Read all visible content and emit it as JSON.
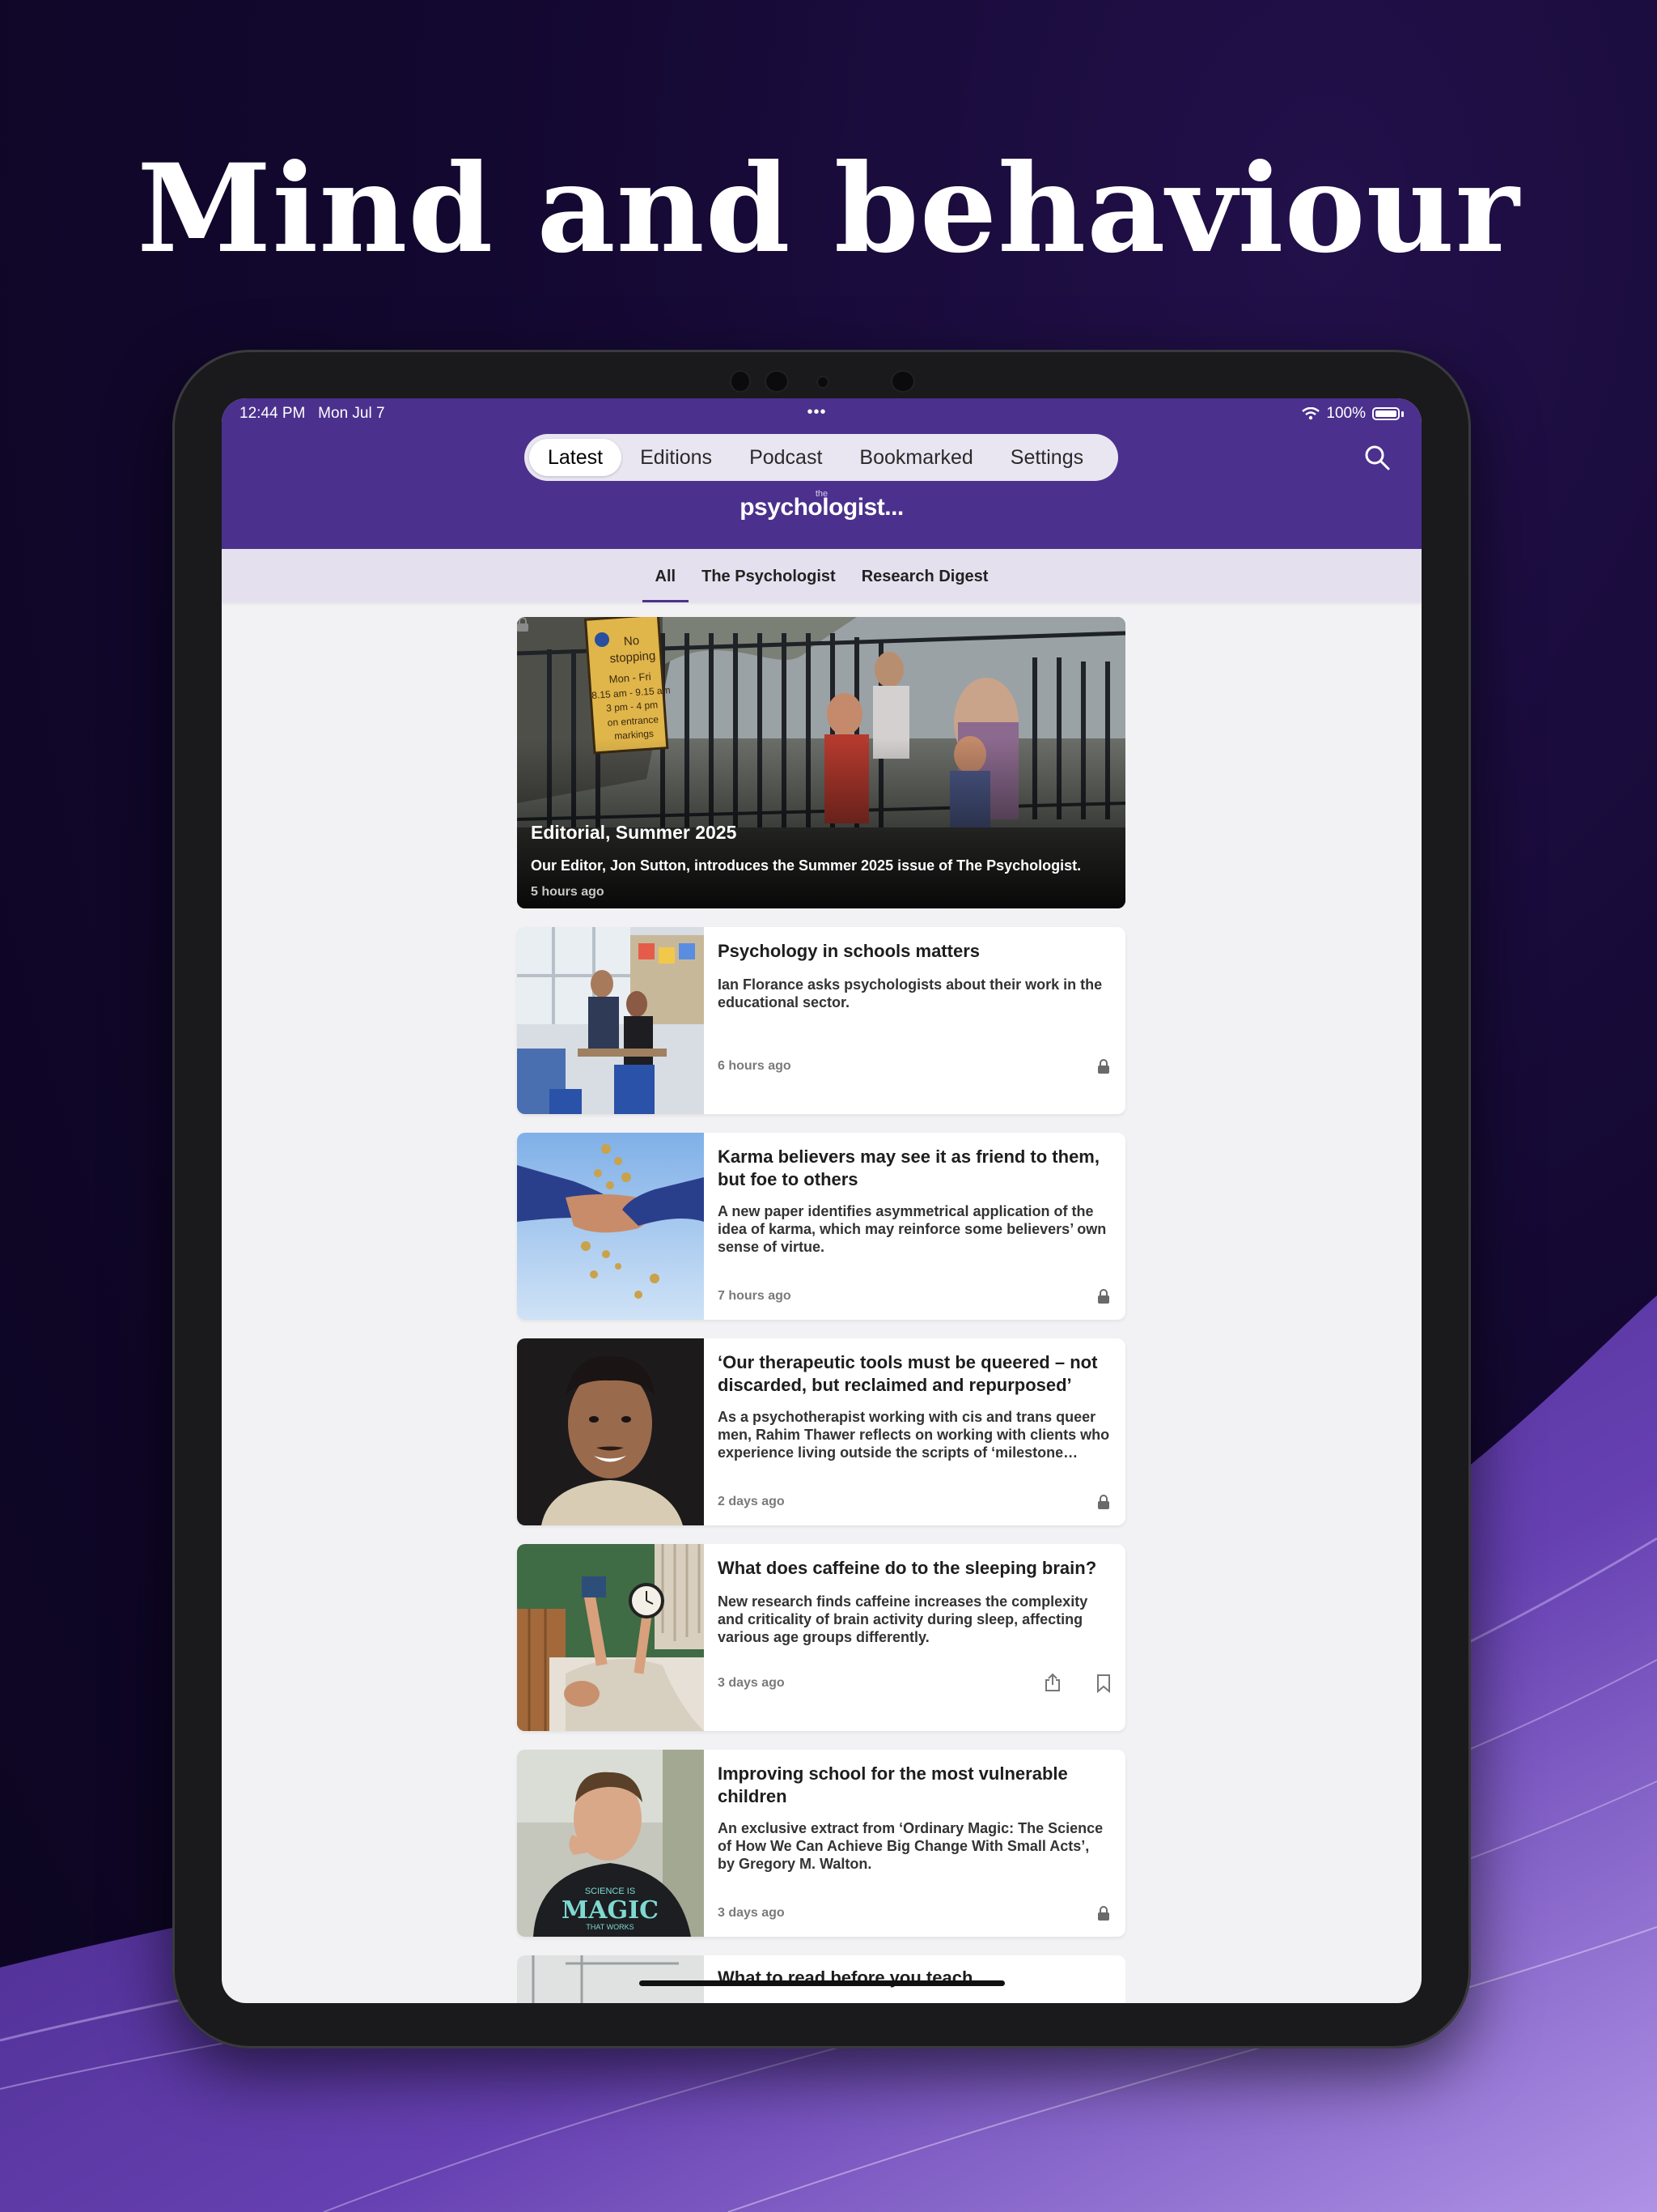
{
  "headline": "Mind and behaviour",
  "status": {
    "time": "12:44 PM",
    "date": "Mon Jul 7",
    "battery": "100%",
    "dots": "•••"
  },
  "nav": {
    "tabs": [
      "Latest",
      "Editions",
      "Podcast",
      "Bookmarked",
      "Settings"
    ],
    "active": "Latest"
  },
  "logo": {
    "small": "the",
    "word": "psychologist",
    "dots": "..."
  },
  "filters": {
    "items": [
      "All",
      "The Psychologist",
      "Research Digest"
    ],
    "active": "All"
  },
  "hero": {
    "title": "Editorial, Summer 2025",
    "summary": "Our Editor, Jon Sutton, introduces the Summer 2025 issue of The Psychologist.",
    "time": "5 hours ago",
    "sign_text": "No stopping Mon - Fri 8.15 am - 9.15 am 3 pm - 4 pm on entrance markings"
  },
  "articles": [
    {
      "title": "Psychology in schools matters",
      "summary": "Ian Florance asks psychologists about their work in the educational sector.",
      "time": "6 hours ago",
      "icon": "lock-icon"
    },
    {
      "title": "Karma believers may see it as friend to them, but foe to others",
      "summary": "A new paper identifies asymmetrical application of the idea of karma, which may reinforce some believers’ own sense of virtue.",
      "time": "7 hours ago",
      "icon": "lock-icon"
    },
    {
      "title": "‘Our therapeutic tools must be queered – not discarded, but reclaimed and repurposed’",
      "summary": "As a psychotherapist working with cis and trans queer men, Rahim Thawer reflects on working with clients who experience living outside the scripts of ‘milestone…",
      "time": "2 days ago",
      "icon": "lock-icon"
    },
    {
      "title": "What does caffeine do to the sleeping brain?",
      "summary": "New research finds caffeine increases the complexity and criticality of brain activity during sleep, affecting various age groups differently.",
      "time": "3 days ago",
      "icon": "share-bookmark"
    },
    {
      "title": "Improving school for the most vulnerable children",
      "summary": "An exclusive extract from ‘Ordinary Magic: The Science of How We Can Achieve Big Change With Small Acts’, by Gregory M. Walton.",
      "time": "3 days ago",
      "icon": "lock-icon",
      "shirt_text": "SCIENCE IS MAGIC THAT WORKS"
    }
  ],
  "partial_article": {
    "title": "What to read before you teach"
  },
  "colors": {
    "brand_purple": "#4b318d",
    "filter_bg": "#e4e0ee",
    "background": "#130830"
  }
}
